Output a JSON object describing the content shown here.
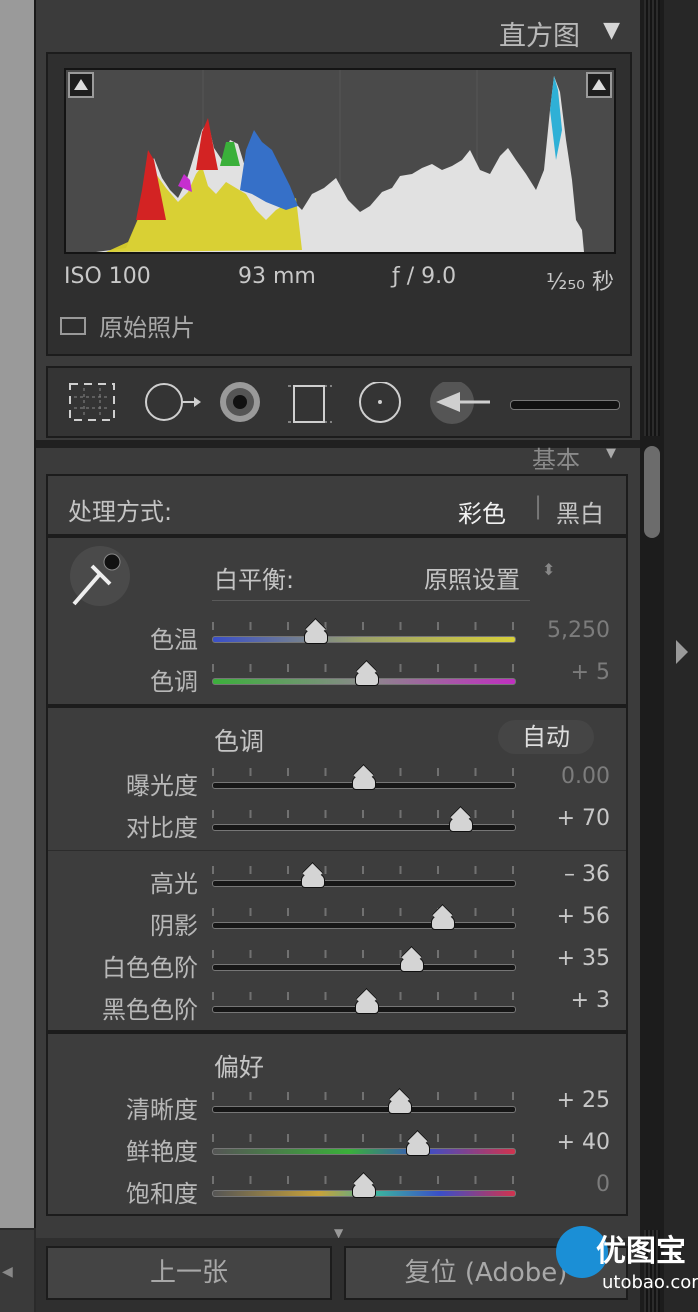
{
  "histogram": {
    "title": "直方图",
    "toggle": "▼",
    "iso": "ISO 100",
    "focal": "93 mm",
    "aperture": "ƒ / 9.0",
    "shutter": "¹⁄₂₅₀ 秒",
    "original_photo_label": "原始照片"
  },
  "basic": {
    "title": "基本",
    "treatment_label": "处理方式:",
    "treatment_color": "彩色",
    "treatment_sep": "|",
    "treatment_bw": "黑白",
    "wb_label": "白平衡:",
    "wb_value": "原照设置",
    "wb_arrows": "⬍",
    "temp_label": "色温",
    "temp_value": "5,250",
    "temp_pos": 0.34,
    "tint_label": "色调",
    "tint_value": "+ 5",
    "tint_pos": 0.51,
    "tone_title": "色调",
    "auto_label": "自动",
    "exposure_label": "曝光度",
    "exposure_value": "0.00",
    "exposure_pos": 0.5,
    "contrast_label": "对比度",
    "contrast_value": "+ 70",
    "contrast_pos": 0.82,
    "highlights_label": "高光",
    "highlights_value": "– 36",
    "highlights_pos": 0.33,
    "shadows_label": "阴影",
    "shadows_value": "+ 56",
    "shadows_pos": 0.76,
    "whites_label": "白色色阶",
    "whites_value": "+ 35",
    "whites_pos": 0.66,
    "blacks_label": "黑色色阶",
    "blacks_value": "+ 3",
    "blacks_pos": 0.51,
    "presence_title": "偏好",
    "clarity_label": "清晰度",
    "clarity_value": "+ 25",
    "clarity_pos": 0.62,
    "vibrance_label": "鲜艳度",
    "vibrance_value": "+ 40",
    "vibrance_pos": 0.68,
    "saturation_label": "饱和度",
    "saturation_value": "0",
    "saturation_pos": 0.5
  },
  "footer": {
    "previous_label": "上一张",
    "reset_label": "复位 (Adobe)"
  },
  "watermark": {
    "text": "优图宝",
    "url": "utobao.com"
  }
}
